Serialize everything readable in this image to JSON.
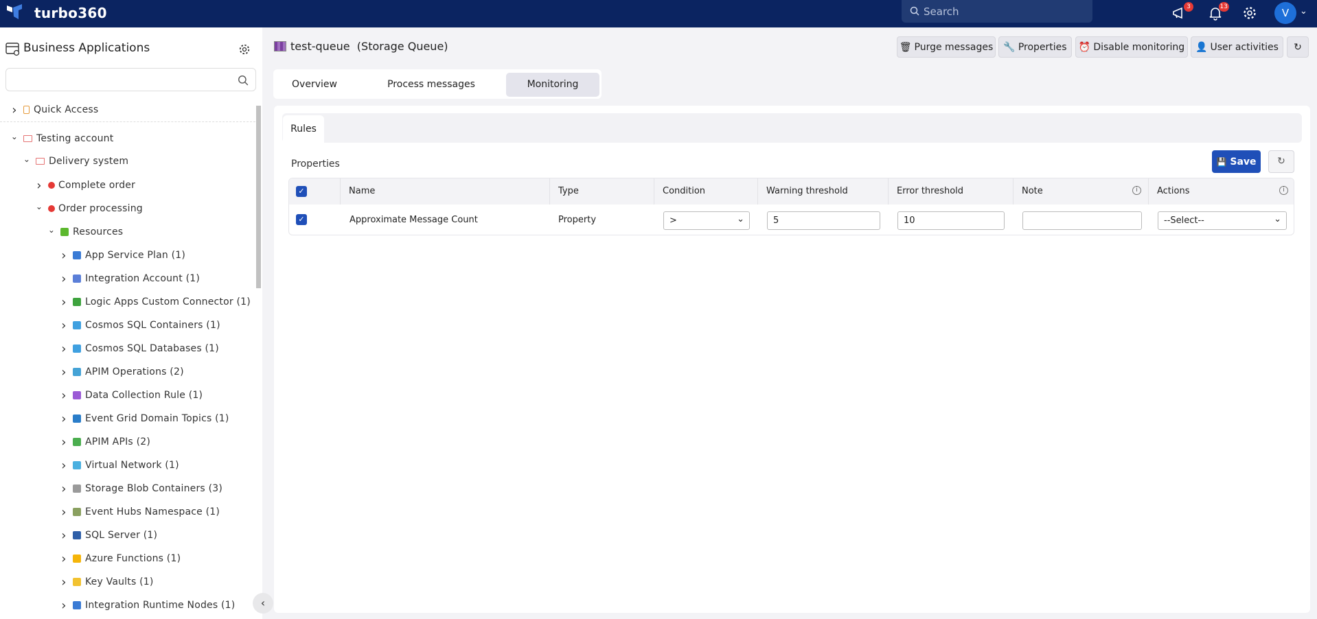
{
  "topbar": {
    "brand": "turbo360",
    "search_placeholder": "Search",
    "announcements_count": "3",
    "notifications_count": "13",
    "avatar_initial": "V"
  },
  "sidebar": {
    "title": "Business Applications",
    "search_value": "",
    "tree": [
      {
        "label": "Quick Access",
        "level": 0,
        "expanded": false,
        "icon": "bookmark-icon"
      },
      {
        "label": "Testing account",
        "level": 0,
        "expanded": true,
        "icon": "folder-icon"
      },
      {
        "label": "Delivery system",
        "level": 1,
        "expanded": true,
        "icon": "folder-icon"
      },
      {
        "label": "Complete order",
        "level": 2,
        "expanded": false,
        "icon": "status-dot-icon",
        "color": "#e53935"
      },
      {
        "label": "Order processing",
        "level": 2,
        "expanded": true,
        "icon": "status-dot-icon",
        "color": "#e53935"
      },
      {
        "label": "Resources",
        "level": 3,
        "expanded": true,
        "icon": "grid-icon",
        "color": "#5cb82e"
      },
      {
        "label": "App Service Plan (1)",
        "level": 4,
        "expanded": false,
        "icon": "app-service-plan-icon",
        "color": "#3a7bd5"
      },
      {
        "label": "Integration Account (1)",
        "level": 4,
        "expanded": false,
        "icon": "integration-account-icon",
        "color": "#5b7fd8"
      },
      {
        "label": "Logic Apps Custom Connector (1)",
        "level": 4,
        "expanded": false,
        "icon": "connector-icon",
        "color": "#3ea33e"
      },
      {
        "label": "Cosmos SQL Containers (1)",
        "level": 4,
        "expanded": false,
        "icon": "cosmos-icon",
        "color": "#3fa0e0"
      },
      {
        "label": "Cosmos SQL Databases (1)",
        "level": 4,
        "expanded": false,
        "icon": "cosmos-icon",
        "color": "#3fa0e0"
      },
      {
        "label": "APIM Operations (2)",
        "level": 4,
        "expanded": false,
        "icon": "apim-operations-icon",
        "color": "#45a3d6"
      },
      {
        "label": "Data Collection Rule (1)",
        "level": 4,
        "expanded": false,
        "icon": "lightbulb-icon",
        "color": "#9b5bd6"
      },
      {
        "label": "Event Grid Domain Topics (1)",
        "level": 4,
        "expanded": false,
        "icon": "event-grid-icon",
        "color": "#2a7dc9"
      },
      {
        "label": "APIM APIs (2)",
        "level": 4,
        "expanded": false,
        "icon": "apim-api-icon",
        "color": "#4bae4f"
      },
      {
        "label": "Virtual Network (1)",
        "level": 4,
        "expanded": false,
        "icon": "virtual-network-icon",
        "color": "#4ab0e0"
      },
      {
        "label": "Storage Blob Containers (3)",
        "level": 4,
        "expanded": false,
        "icon": "blob-container-icon",
        "color": "#9a9a9a"
      },
      {
        "label": "Event Hubs Namespace (1)",
        "level": 4,
        "expanded": false,
        "icon": "event-hubs-icon",
        "color": "#8aa060"
      },
      {
        "label": "SQL Server (1)",
        "level": 4,
        "expanded": false,
        "icon": "sql-server-icon",
        "color": "#2f5fa8"
      },
      {
        "label": "Azure Functions (1)",
        "level": 4,
        "expanded": false,
        "icon": "azure-functions-icon",
        "color": "#f5b50a"
      },
      {
        "label": "Key Vaults (1)",
        "level": 4,
        "expanded": false,
        "icon": "key-vault-icon",
        "color": "#f2c230"
      },
      {
        "label": "Integration Runtime Nodes (1)",
        "level": 4,
        "expanded": false,
        "icon": "runtime-nodes-icon",
        "color": "#3a7bd5"
      }
    ]
  },
  "header": {
    "resource_name": "test-queue",
    "resource_type": "(Storage Queue)",
    "actions": [
      "Purge messages",
      "Properties",
      "Disable monitoring",
      "User activities"
    ]
  },
  "tabs": [
    {
      "label": "Overview",
      "active": false
    },
    {
      "label": "Process messages",
      "active": false
    },
    {
      "label": "Monitoring",
      "active": true
    }
  ],
  "subtabs": {
    "rules": "Rules"
  },
  "properties": {
    "title": "Properties",
    "save_label": "Save",
    "columns": [
      "Name",
      "Type",
      "Condition",
      "Warning threshold",
      "Error threshold",
      "Note",
      "Actions"
    ],
    "rows": [
      {
        "checked": true,
        "name": "Approximate Message Count",
        "type": "Property",
        "condition": ">",
        "warning": "5",
        "error": "10",
        "note": "",
        "action": "--Select--"
      }
    ],
    "all_checked": true
  },
  "colors": {
    "topbar": "#0b2461",
    "primary": "#1f4fb8",
    "alert": "#e53935"
  }
}
